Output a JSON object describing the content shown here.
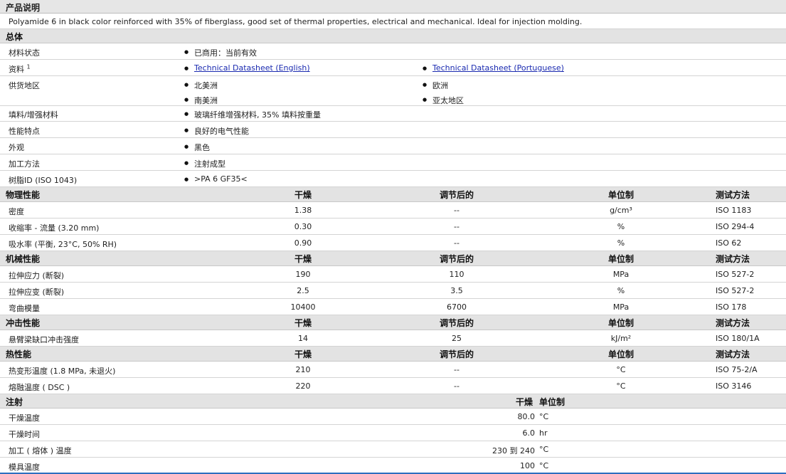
{
  "desc_header": "产品说明",
  "description": "Polyamide 6 in black color reinforced with 35% of fiberglass, good set of thermal properties, electrical and mechanical. Ideal for injection molding.",
  "general": {
    "title": "总体",
    "status_label": "材料状态",
    "status_value": "已商用：当前有效",
    "docs_label": "资料",
    "docs_sup": "1",
    "doc_link_en": "Technical Datasheet (English)",
    "doc_link_pt": "Technical Datasheet (Portuguese)",
    "regions_label": "供货地区",
    "regions": [
      "北美洲",
      "欧洲",
      "南美洲",
      "亚太地区"
    ],
    "filler_label": "填料/增强材料",
    "filler_value": "玻璃纤维增强材料, 35% 填料按重量",
    "features_label": "性能特点",
    "features_value": "良好的电气性能",
    "appearance_label": "外观",
    "appearance_value": "黑色",
    "processing_label": "加工方法",
    "processing_value": "注射成型",
    "resin_label": "树脂ID (ISO 1043)",
    "resin_value": ">PA 6 GF35<"
  },
  "columns": {
    "dry": "干燥",
    "cond": "调节后的",
    "unit": "单位制",
    "method": "测试方法"
  },
  "physical": {
    "title": "物理性能",
    "rows": [
      {
        "name": "密度",
        "dry": "1.38",
        "cond": "--",
        "unit": "g/cm³",
        "method": "ISO 1183"
      },
      {
        "name": "收缩率 - 流量 (3.20 mm)",
        "dry": "0.30",
        "cond": "--",
        "unit": "%",
        "method": "ISO 294-4"
      },
      {
        "name": "吸水率 (平衡, 23°C, 50% RH)",
        "dry": "0.90",
        "cond": "--",
        "unit": "%",
        "method": "ISO 62"
      }
    ]
  },
  "mechanical": {
    "title": "机械性能",
    "rows": [
      {
        "name": "拉伸应力 (断裂)",
        "dry": "190",
        "cond": "110",
        "unit": "MPa",
        "method": "ISO 527-2"
      },
      {
        "name": "拉伸应变 (断裂)",
        "dry": "2.5",
        "cond": "3.5",
        "unit": "%",
        "method": "ISO 527-2"
      },
      {
        "name": "弯曲模量",
        "dry": "10400",
        "cond": "6700",
        "unit": "MPa",
        "method": "ISO 178"
      }
    ]
  },
  "impact": {
    "title": "冲击性能",
    "rows": [
      {
        "name": "悬臂梁缺口冲击强度",
        "dry": "14",
        "cond": "25",
        "unit": "kJ/m²",
        "method": "ISO 180/1A"
      }
    ]
  },
  "thermal": {
    "title": "热性能",
    "rows": [
      {
        "name": "热变形温度 (1.8 MPa, 未退火)",
        "dry": "210",
        "cond": "--",
        "unit": "°C",
        "method": "ISO 75-2/A"
      },
      {
        "name": "熔融温度 ( DSC )",
        "dry": "220",
        "cond": "--",
        "unit": "°C",
        "method": "ISO 3146"
      }
    ]
  },
  "injection": {
    "title": "注射",
    "col_dry": "干燥",
    "col_unit": "单位制",
    "rows": [
      {
        "name": "干燥温度",
        "value": "80.0",
        "unit": "°C"
      },
      {
        "name": "干燥时间",
        "value": "6.0",
        "unit": "hr"
      },
      {
        "name": "加工 ( 熔体 ) 温度",
        "value": "230 到 240",
        "unit": "°C"
      },
      {
        "name": "模具温度",
        "value": "100",
        "unit": "°C"
      }
    ]
  }
}
